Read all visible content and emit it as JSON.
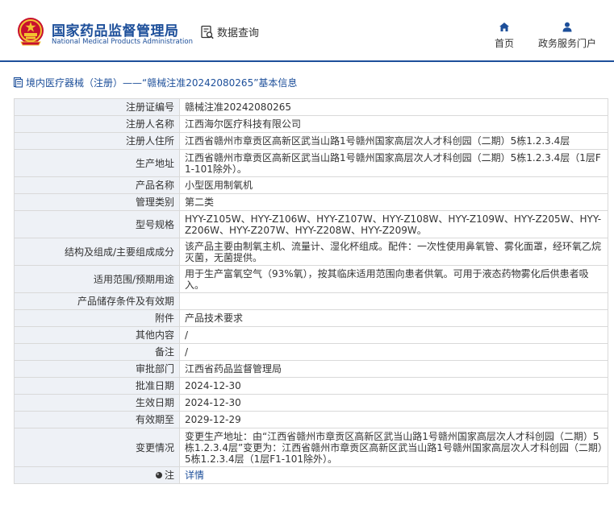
{
  "header": {
    "agency_cn": "国家药品监督管理局",
    "agency_en": "National Medical Products Administration",
    "data_query_label": "数据查询",
    "nav": [
      {
        "label": "首页",
        "icon": "home-icon"
      },
      {
        "label": "政务服务门户",
        "icon": "user-icon"
      }
    ],
    "accent_color": "#1d4f9a"
  },
  "breadcrumb": {
    "text": "境内医疗器械（注册）——“赣械注准20242080265”基本信息",
    "icon": "document-icon"
  },
  "record": {
    "rows": [
      {
        "label": "注册证编号",
        "value": "赣械注准20242080265"
      },
      {
        "label": "注册人名称",
        "value": "江西海尔医疗科技有限公司"
      },
      {
        "label": "注册人住所",
        "value": "江西省赣州市章贡区高新区武当山路1号赣州国家高层次人才科创园（二期）5栋1.2.3.4层"
      },
      {
        "label": "生产地址",
        "value": "江西省赣州市章贡区高新区武当山路1号赣州国家高层次人才科创园（二期）5栋1.2.3.4层（1层F1-101除外）。"
      },
      {
        "label": "产品名称",
        "value": "小型医用制氧机"
      },
      {
        "label": "管理类别",
        "value": "第二类"
      },
      {
        "label": "型号规格",
        "value": "HYY-Z105W、HYY-Z106W、HYY-Z107W、HYY-Z108W、HYY-Z109W、HYY-Z205W、HYY-Z206W、HYY-Z207W、HYY-Z208W、HYY-Z209W。"
      },
      {
        "label": "结构及组成/主要组成成分",
        "value": "该产品主要由制氧主机、流量计、湿化杯组成。配件：一次性使用鼻氧管、雾化面罩，经环氧乙烷灭菌，无菌提供。"
      },
      {
        "label": "适用范围/预期用途",
        "value": "用于生产富氧空气（93%氧），按其临床适用范围向患者供氧。可用于液态药物雾化后供患者吸入。"
      },
      {
        "label": "产品储存条件及有效期",
        "value": ""
      },
      {
        "label": "附件",
        "value": "产品技术要求"
      },
      {
        "label": "其他内容",
        "value": "/"
      },
      {
        "label": "备注",
        "value": "/"
      },
      {
        "label": "审批部门",
        "value": "江西省药品监督管理局"
      },
      {
        "label": "批准日期",
        "value": "2024-12-30"
      },
      {
        "label": "生效日期",
        "value": "2024-12-30"
      },
      {
        "label": "有效期至",
        "value": "2029-12-29"
      },
      {
        "label": "变更情况",
        "value": "变更生产地址：由“江西省赣州市章贡区高新区武当山路1号赣州国家高层次人才科创园（二期）5栋1.2.3.4层”变更为：江西省赣州市章贡区高新区武当山路1号赣州国家高层次人才科创园（二期）5栋1.2.3.4层（1层F1-101除外）。"
      }
    ],
    "note": {
      "label": "注",
      "link": "详情"
    }
  }
}
